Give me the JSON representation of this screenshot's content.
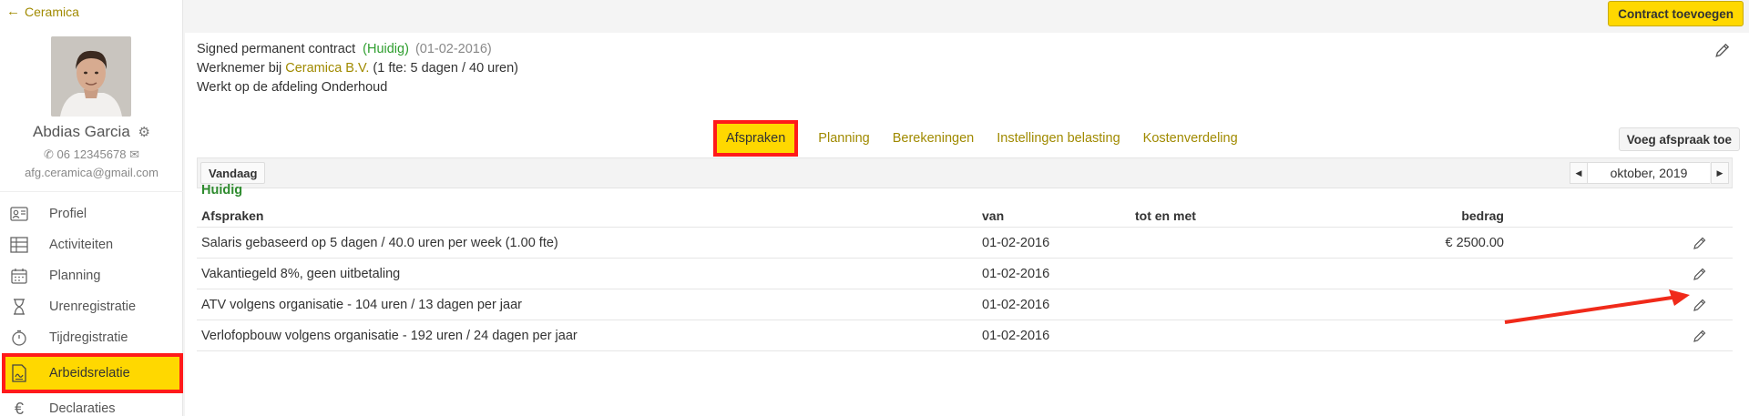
{
  "header": {
    "back_label": "Ceramica",
    "add_contract_label": "Contract toevoegen"
  },
  "user": {
    "name": "Abdias Garcia",
    "phone": "06 12345678",
    "email": "afg.ceramica@gmail.com"
  },
  "sidebar": {
    "items": [
      {
        "label": "Profiel",
        "icon": "profile-card-icon"
      },
      {
        "label": "Activiteiten",
        "icon": "table-icon"
      },
      {
        "label": "Planning",
        "icon": "calendar-icon"
      },
      {
        "label": "Urenregistratie",
        "icon": "hourglass-icon"
      },
      {
        "label": "Tijdregistratie",
        "icon": "stopwatch-icon"
      },
      {
        "label": "Arbeidsrelatie",
        "icon": "contract-document-icon",
        "active": true
      },
      {
        "label": "Declaraties",
        "icon": "euro-icon"
      }
    ]
  },
  "contract": {
    "title": "Signed permanent contract",
    "status": "(Huidig)",
    "date": "(01-02-2016)",
    "employee_prefix": "Werknemer bij",
    "employer": "Ceramica B.V.",
    "employee_suffix": "(1 fte: 5 dagen / 40 uren)",
    "department": "Werkt op de afdeling Onderhoud"
  },
  "tabs": [
    {
      "label": "Afspraken",
      "active": true
    },
    {
      "label": "Planning"
    },
    {
      "label": "Berekeningen"
    },
    {
      "label": "Instellingen belasting"
    },
    {
      "label": "Kostenverdeling"
    }
  ],
  "add_agreement_label": "Voeg afspraak toe",
  "toolbar": {
    "today_label": "Vandaag",
    "month": "oktober, 2019"
  },
  "section_label": "Huidig",
  "table": {
    "headers": [
      "Afspraken",
      "van",
      "tot en met",
      "bedrag"
    ],
    "rows": [
      {
        "afspraak": "Salaris gebaseerd op 5 dagen / 40.0 uren per week (1.00 fte)",
        "van": "01-02-2016",
        "tot": "",
        "bedrag": "€ 2500.00"
      },
      {
        "afspraak": "Vakantiegeld 8%, geen uitbetaling",
        "van": "01-02-2016",
        "tot": "",
        "bedrag": ""
      },
      {
        "afspraak": "ATV volgens organisatie - 104 uren / 13 dagen per jaar",
        "van": "01-02-2016",
        "tot": "",
        "bedrag": ""
      },
      {
        "afspraak": "Verlofopbouw volgens organisatie - 192 uren / 24 dagen per jaar",
        "van": "01-02-2016",
        "tot": "",
        "bedrag": ""
      }
    ]
  },
  "colors": {
    "accent": "#ffd800",
    "link": "#a08a00",
    "status_green": "#2e9e2e",
    "highlight_red": "#ff1a1a"
  }
}
